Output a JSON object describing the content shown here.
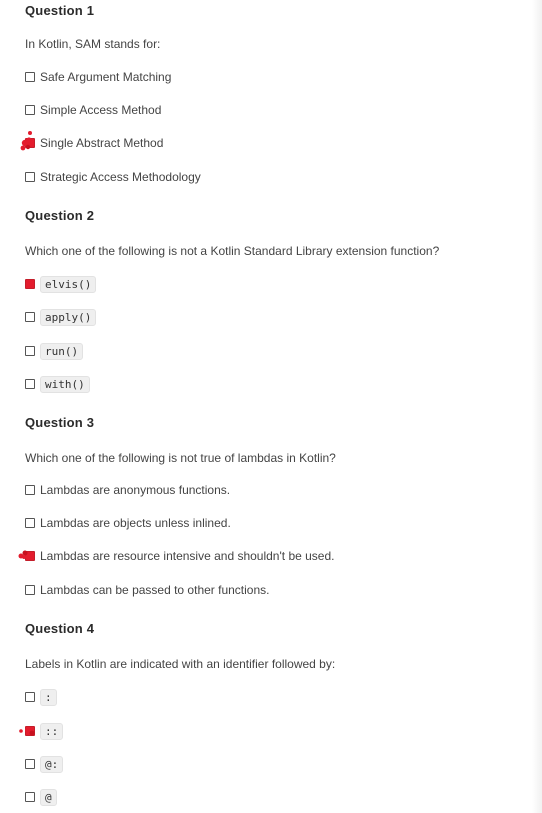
{
  "accent_color": "#e31c2d",
  "questions": [
    {
      "title": "Question 1",
      "prompt": "In Kotlin, SAM stands for:",
      "options": [
        {
          "label": "Safe Argument Matching"
        },
        {
          "label": "Simple Access Method"
        },
        {
          "label": "Single Abstract Method"
        },
        {
          "label": "Strategic Access Methodology"
        }
      ]
    },
    {
      "title": "Question 2",
      "prompt": "Which one of the following is not a Kotlin Standard Library extension function?",
      "options": [
        {
          "label": "elvis()"
        },
        {
          "label": "apply()"
        },
        {
          "label": "run()"
        },
        {
          "label": "with()"
        }
      ]
    },
    {
      "title": "Question 3",
      "prompt": "Which one of the following is not true of lambdas in Kotlin?",
      "options": [
        {
          "label": "Lambdas are anonymous functions."
        },
        {
          "label": "Lambdas are objects unless inlined."
        },
        {
          "label": "Lambdas are resource intensive and shouldn't be used."
        },
        {
          "label": "Lambdas can be passed to other functions."
        }
      ]
    },
    {
      "title": "Question 4",
      "prompt": "Labels in Kotlin are indicated with an identifier followed by:",
      "options": [
        {
          "label": ":"
        },
        {
          "label": "::"
        },
        {
          "label": "@:"
        },
        {
          "label": "@"
        }
      ]
    }
  ]
}
